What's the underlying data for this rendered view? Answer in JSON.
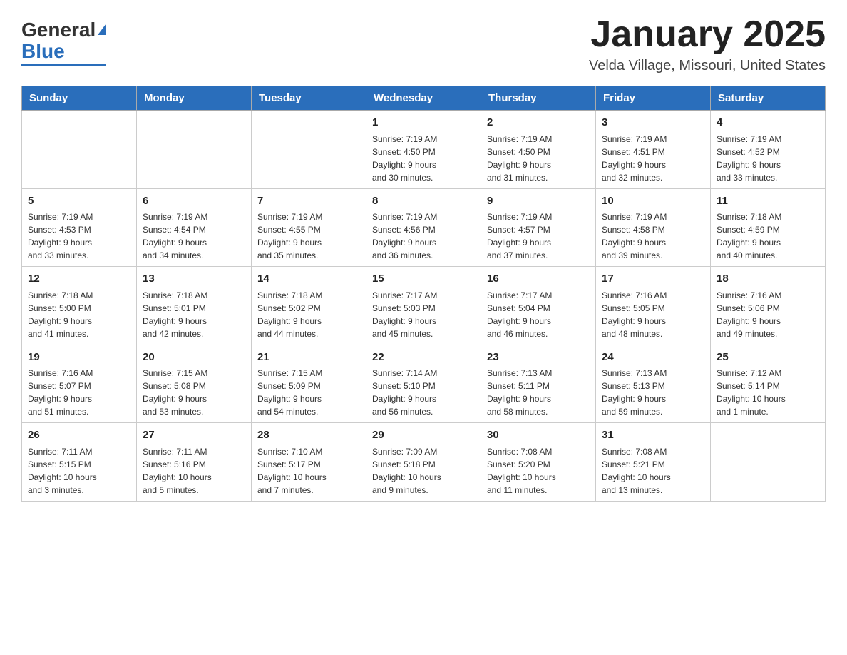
{
  "header": {
    "logo": {
      "general": "General",
      "blue": "Blue",
      "arrow": "▶"
    },
    "title": "January 2025",
    "location": "Velda Village, Missouri, United States"
  },
  "days_of_week": [
    "Sunday",
    "Monday",
    "Tuesday",
    "Wednesday",
    "Thursday",
    "Friday",
    "Saturday"
  ],
  "weeks": [
    [
      {
        "day": "",
        "info": ""
      },
      {
        "day": "",
        "info": ""
      },
      {
        "day": "",
        "info": ""
      },
      {
        "day": "1",
        "info": "Sunrise: 7:19 AM\nSunset: 4:50 PM\nDaylight: 9 hours\nand 30 minutes."
      },
      {
        "day": "2",
        "info": "Sunrise: 7:19 AM\nSunset: 4:50 PM\nDaylight: 9 hours\nand 31 minutes."
      },
      {
        "day": "3",
        "info": "Sunrise: 7:19 AM\nSunset: 4:51 PM\nDaylight: 9 hours\nand 32 minutes."
      },
      {
        "day": "4",
        "info": "Sunrise: 7:19 AM\nSunset: 4:52 PM\nDaylight: 9 hours\nand 33 minutes."
      }
    ],
    [
      {
        "day": "5",
        "info": "Sunrise: 7:19 AM\nSunset: 4:53 PM\nDaylight: 9 hours\nand 33 minutes."
      },
      {
        "day": "6",
        "info": "Sunrise: 7:19 AM\nSunset: 4:54 PM\nDaylight: 9 hours\nand 34 minutes."
      },
      {
        "day": "7",
        "info": "Sunrise: 7:19 AM\nSunset: 4:55 PM\nDaylight: 9 hours\nand 35 minutes."
      },
      {
        "day": "8",
        "info": "Sunrise: 7:19 AM\nSunset: 4:56 PM\nDaylight: 9 hours\nand 36 minutes."
      },
      {
        "day": "9",
        "info": "Sunrise: 7:19 AM\nSunset: 4:57 PM\nDaylight: 9 hours\nand 37 minutes."
      },
      {
        "day": "10",
        "info": "Sunrise: 7:19 AM\nSunset: 4:58 PM\nDaylight: 9 hours\nand 39 minutes."
      },
      {
        "day": "11",
        "info": "Sunrise: 7:18 AM\nSunset: 4:59 PM\nDaylight: 9 hours\nand 40 minutes."
      }
    ],
    [
      {
        "day": "12",
        "info": "Sunrise: 7:18 AM\nSunset: 5:00 PM\nDaylight: 9 hours\nand 41 minutes."
      },
      {
        "day": "13",
        "info": "Sunrise: 7:18 AM\nSunset: 5:01 PM\nDaylight: 9 hours\nand 42 minutes."
      },
      {
        "day": "14",
        "info": "Sunrise: 7:18 AM\nSunset: 5:02 PM\nDaylight: 9 hours\nand 44 minutes."
      },
      {
        "day": "15",
        "info": "Sunrise: 7:17 AM\nSunset: 5:03 PM\nDaylight: 9 hours\nand 45 minutes."
      },
      {
        "day": "16",
        "info": "Sunrise: 7:17 AM\nSunset: 5:04 PM\nDaylight: 9 hours\nand 46 minutes."
      },
      {
        "day": "17",
        "info": "Sunrise: 7:16 AM\nSunset: 5:05 PM\nDaylight: 9 hours\nand 48 minutes."
      },
      {
        "day": "18",
        "info": "Sunrise: 7:16 AM\nSunset: 5:06 PM\nDaylight: 9 hours\nand 49 minutes."
      }
    ],
    [
      {
        "day": "19",
        "info": "Sunrise: 7:16 AM\nSunset: 5:07 PM\nDaylight: 9 hours\nand 51 minutes."
      },
      {
        "day": "20",
        "info": "Sunrise: 7:15 AM\nSunset: 5:08 PM\nDaylight: 9 hours\nand 53 minutes."
      },
      {
        "day": "21",
        "info": "Sunrise: 7:15 AM\nSunset: 5:09 PM\nDaylight: 9 hours\nand 54 minutes."
      },
      {
        "day": "22",
        "info": "Sunrise: 7:14 AM\nSunset: 5:10 PM\nDaylight: 9 hours\nand 56 minutes."
      },
      {
        "day": "23",
        "info": "Sunrise: 7:13 AM\nSunset: 5:11 PM\nDaylight: 9 hours\nand 58 minutes."
      },
      {
        "day": "24",
        "info": "Sunrise: 7:13 AM\nSunset: 5:13 PM\nDaylight: 9 hours\nand 59 minutes."
      },
      {
        "day": "25",
        "info": "Sunrise: 7:12 AM\nSunset: 5:14 PM\nDaylight: 10 hours\nand 1 minute."
      }
    ],
    [
      {
        "day": "26",
        "info": "Sunrise: 7:11 AM\nSunset: 5:15 PM\nDaylight: 10 hours\nand 3 minutes."
      },
      {
        "day": "27",
        "info": "Sunrise: 7:11 AM\nSunset: 5:16 PM\nDaylight: 10 hours\nand 5 minutes."
      },
      {
        "day": "28",
        "info": "Sunrise: 7:10 AM\nSunset: 5:17 PM\nDaylight: 10 hours\nand 7 minutes."
      },
      {
        "day": "29",
        "info": "Sunrise: 7:09 AM\nSunset: 5:18 PM\nDaylight: 10 hours\nand 9 minutes."
      },
      {
        "day": "30",
        "info": "Sunrise: 7:08 AM\nSunset: 5:20 PM\nDaylight: 10 hours\nand 11 minutes."
      },
      {
        "day": "31",
        "info": "Sunrise: 7:08 AM\nSunset: 5:21 PM\nDaylight: 10 hours\nand 13 minutes."
      },
      {
        "day": "",
        "info": ""
      }
    ]
  ]
}
